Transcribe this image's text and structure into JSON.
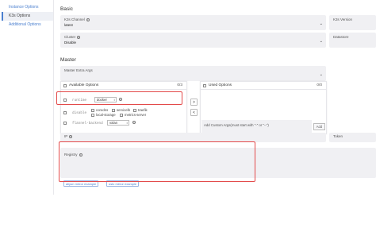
{
  "sidebar": {
    "items": [
      {
        "label": "Instance Options"
      },
      {
        "label": "K3s Options"
      },
      {
        "label": "Additional Options"
      }
    ]
  },
  "basic": {
    "title": "Basic",
    "k3s_channel": {
      "label": "K3s Channel",
      "value": "latest"
    },
    "k3s_version": {
      "label": "K3s Version"
    },
    "cluster": {
      "label": "Cluster",
      "value": "Disable"
    },
    "datastore": {
      "label": "Datastore"
    }
  },
  "master": {
    "title": "Master",
    "extra_args": {
      "label": "Master Extra Args"
    },
    "available": {
      "label": "Available Options",
      "count": "0/3"
    },
    "used": {
      "label": "Used Options",
      "count": "0/0"
    },
    "options": {
      "runtime": {
        "flag": "runtime",
        "value": "docker"
      },
      "disable": {
        "flag": "disable",
        "checks": [
          "coredns",
          "servicelb",
          "traefik",
          "local-storage",
          "metrics-server"
        ]
      },
      "flannel": {
        "flag": "flannel-backend",
        "value": "vxlan"
      }
    },
    "move_right": ">",
    "move_left": "<",
    "custom_placeholder": "Add Custom Args(must start with \"-\" or \"--\")",
    "add_label": "Add",
    "ip": {
      "label": "IP"
    },
    "token": {
      "label": "Token"
    }
  },
  "registry": {
    "label": "Registry",
    "aliyun_example": "aliyun mirror example",
    "ustc_example": "ustc mirror example"
  },
  "colors": {
    "accent": "#4a7fcf",
    "highlight": "#e34a4a"
  }
}
